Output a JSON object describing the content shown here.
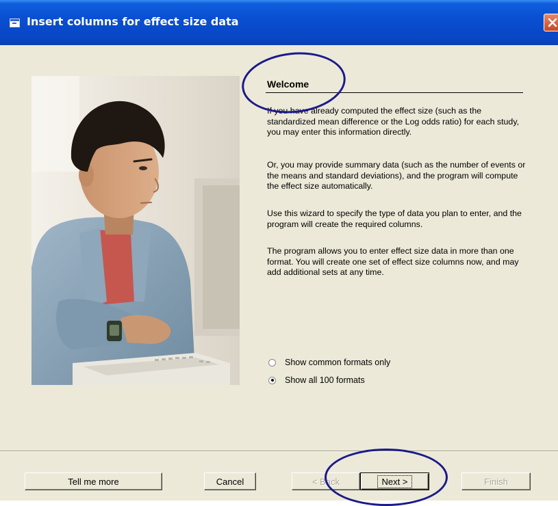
{
  "window": {
    "title": "Insert columns for effect size data",
    "icons": [
      "window-icon",
      "close-icon"
    ]
  },
  "content": {
    "heading": "Welcome",
    "paragraphs": [
      "If you have already computed the effect size (such as the standardized mean difference or the Log odds ratio) for each study, you may enter this information directly.",
      "Or, you may provide summary data (such as the number of events or the means and standard deviations), and the program will compute the effect size automatically.",
      "Use this wizard to specify the type of data you plan to enter, and the program will create the required columns.",
      "The program allows you to enter effect size data in more than one format.  You will create one set of effect size columns now, and may add additional sets at any time."
    ]
  },
  "options": [
    {
      "label": "Show common formats only",
      "selected": false
    },
    {
      "label": "Show all 100 formats",
      "selected": true
    }
  ],
  "buttons": {
    "tell_me_more": "Tell me more",
    "cancel": "Cancel",
    "back": "< Back",
    "next": "Next >",
    "finish": "Finish"
  },
  "colors": {
    "titlebar": "#0a4fd1",
    "dialog_bg": "#ece9d8",
    "annotation": "#1a1a8c"
  }
}
